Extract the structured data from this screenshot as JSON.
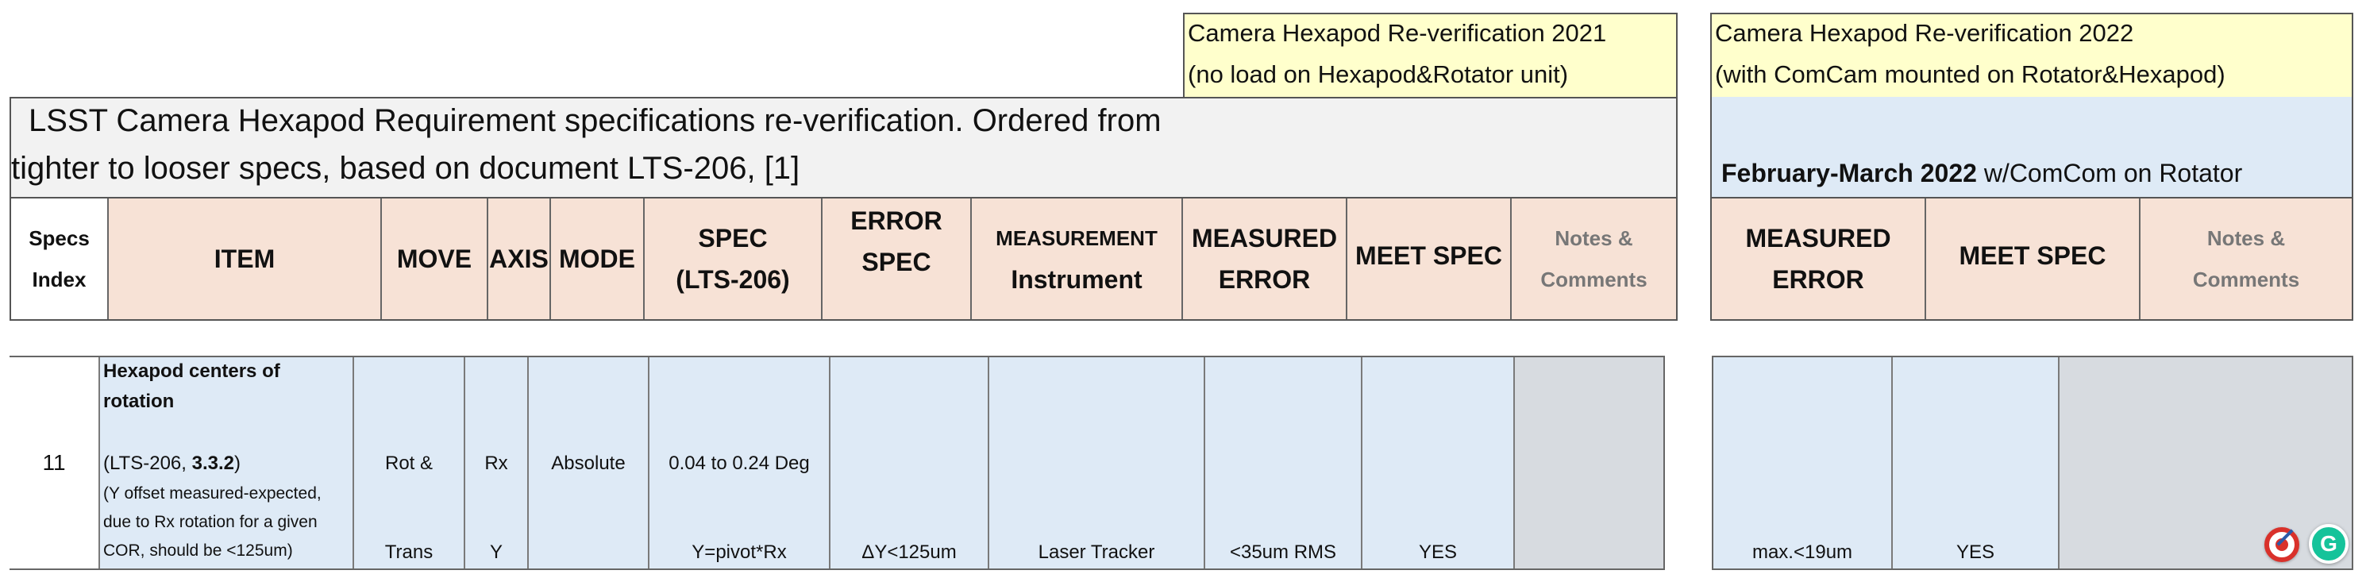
{
  "group2021": {
    "line1": "Camera Hexapod Re-verification 2021",
    "line2": "(no load on Hexapod&Rotator unit)"
  },
  "group2022": {
    "line1": "Camera Hexapod Re-verification 2022",
    "line2": "(with ComCam mounted on Rotator&Hexapod)"
  },
  "main_title": {
    "line1": "LSST Camera Hexapod Requirement specifications re-verification. Ordered from",
    "line2": "tighter to looser specs, based on document LTS-206, [1]"
  },
  "date_banner": {
    "bold": "February-March 2022",
    "rest": " w/ComCom on Rotator"
  },
  "headers": {
    "specs_index_1": "Specs",
    "specs_index_2": "Index",
    "item": "ITEM",
    "move": "MOVE",
    "axis": "AXIS",
    "mode": "MODE",
    "spec_1": "SPEC",
    "spec_2": "(LTS-206)",
    "error_spec_1": "ERROR",
    "error_spec_2": "SPEC",
    "measurement_1": "MEASUREMENT",
    "measurement_2": "Instrument",
    "measured_error_1": "MEASURED",
    "measured_error_2": "ERROR",
    "meet_spec": "MEET SPEC",
    "notes_1": "Notes &",
    "notes_2": "Comments"
  },
  "row": {
    "index": "11",
    "item_title_1": "Hexapod centers of",
    "item_title_2": "rotation",
    "item_ref_pre": "(LTS-206, ",
    "item_ref_bold": "3.3.2",
    "item_ref_post": ")",
    "item_note_1": "(Y offset measured-expected,",
    "item_note_2": "due to Rx rotation for a given",
    "item_note_3": "COR, should be <125um)",
    "move_1": "Rot &",
    "move_2": "Trans",
    "axis_1": "Rx",
    "axis_2": "Y",
    "mode": "Absolute",
    "spec_1": "0.04 to 0.24 Deg",
    "spec_2": "Y=pivot*Rx",
    "error_spec": "ΔY<125um",
    "instrument": "Laser Tracker",
    "measured_2021": "<35um RMS",
    "meet_2021": "YES",
    "measured_2022": "max.<19um",
    "meet_2022": "YES"
  },
  "icons": [
    "target-icon",
    "grammarly-icon"
  ],
  "colors": {
    "yellow": "#ffffcc",
    "header_peach": "#f7e2d6",
    "row_blue": "#deeaf6",
    "notes_grey": "#d7dbe0",
    "title_grey": "#f2f2f2"
  }
}
